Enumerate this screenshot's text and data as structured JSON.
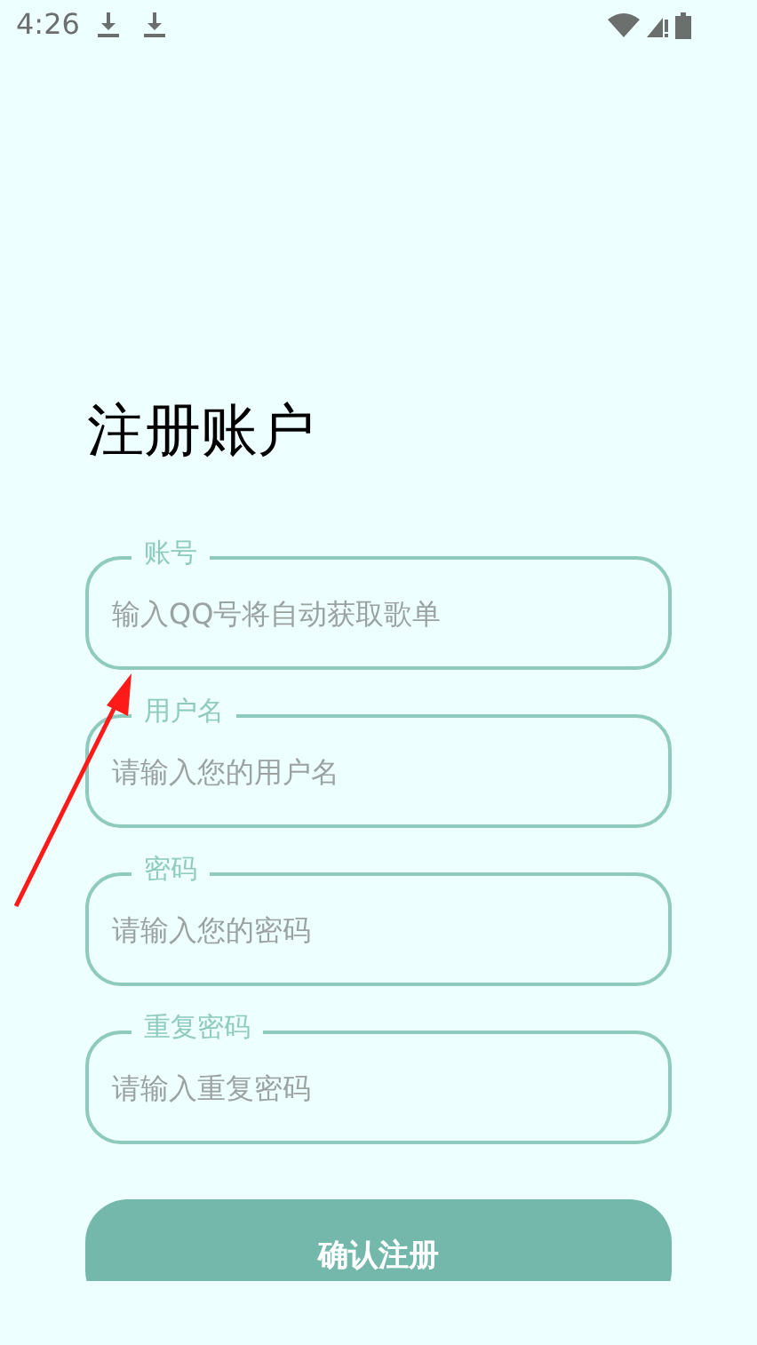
{
  "status_bar": {
    "time": "4:26"
  },
  "title": "注册账户",
  "fields": [
    {
      "label": "账号",
      "placeholder": "输入QQ号将自动获取歌单"
    },
    {
      "label": "用户名",
      "placeholder": "请输入您的用户名"
    },
    {
      "label": "密码",
      "placeholder": "请输入您的密码"
    },
    {
      "label": "重复密码",
      "placeholder": "请输入重复密码"
    }
  ],
  "submit_button": "确认注册"
}
